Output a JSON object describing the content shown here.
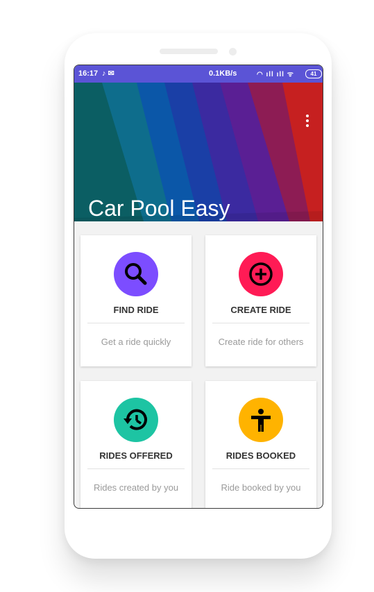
{
  "status_bar": {
    "time": "16:17",
    "network_speed": "0.1KB/s",
    "battery": "41"
  },
  "app": {
    "title": "Car Pool Easy",
    "overflow_menu_icon": "more-vert-icon"
  },
  "cards": [
    {
      "title": "FIND RIDE",
      "subtitle": "Get a ride quickly",
      "icon": "search-icon",
      "color": "#7c4dff"
    },
    {
      "title": "CREATE RIDE",
      "subtitle": "Create ride for others",
      "icon": "add-circle-icon",
      "color": "#ff1b55"
    },
    {
      "title": "RIDES OFFERED",
      "subtitle": "Rides created by you",
      "icon": "history-icon",
      "color": "#1dc4a3"
    },
    {
      "title": "RIDES BOOKED",
      "subtitle": "Ride booked by you",
      "icon": "person-icon",
      "color": "#ffb300"
    }
  ],
  "colors": {
    "status_bar": "#5b54d6",
    "background": "#f2f2f2"
  }
}
